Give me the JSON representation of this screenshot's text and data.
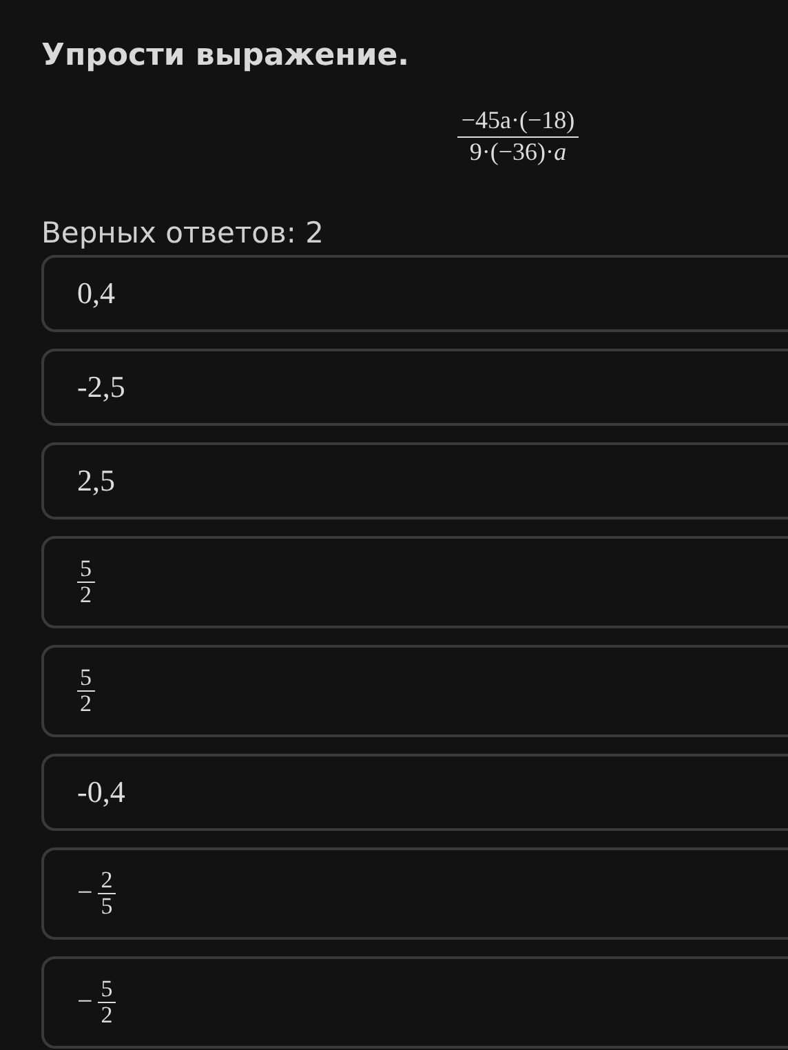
{
  "title": "Упрости выражение.",
  "expression": {
    "numerator": "−45a·(−18)",
    "denominator": "9·(−36)·*a*"
  },
  "answers_label": "Верных ответов: 2",
  "options": [
    {
      "kind": "number",
      "text": "0,4"
    },
    {
      "kind": "number",
      "text": "-2,5"
    },
    {
      "kind": "number",
      "text": "2,5"
    },
    {
      "kind": "fraction",
      "numerator": "5",
      "denominator": "2"
    },
    {
      "kind": "fraction",
      "numerator": "5",
      "denominator": "2"
    },
    {
      "kind": "number",
      "text": "-0,4"
    },
    {
      "kind": "fraction",
      "sign": "−",
      "numerator": "2",
      "denominator": "5"
    },
    {
      "kind": "fraction",
      "sign": "−",
      "numerator": "5",
      "denominator": "2"
    }
  ]
}
